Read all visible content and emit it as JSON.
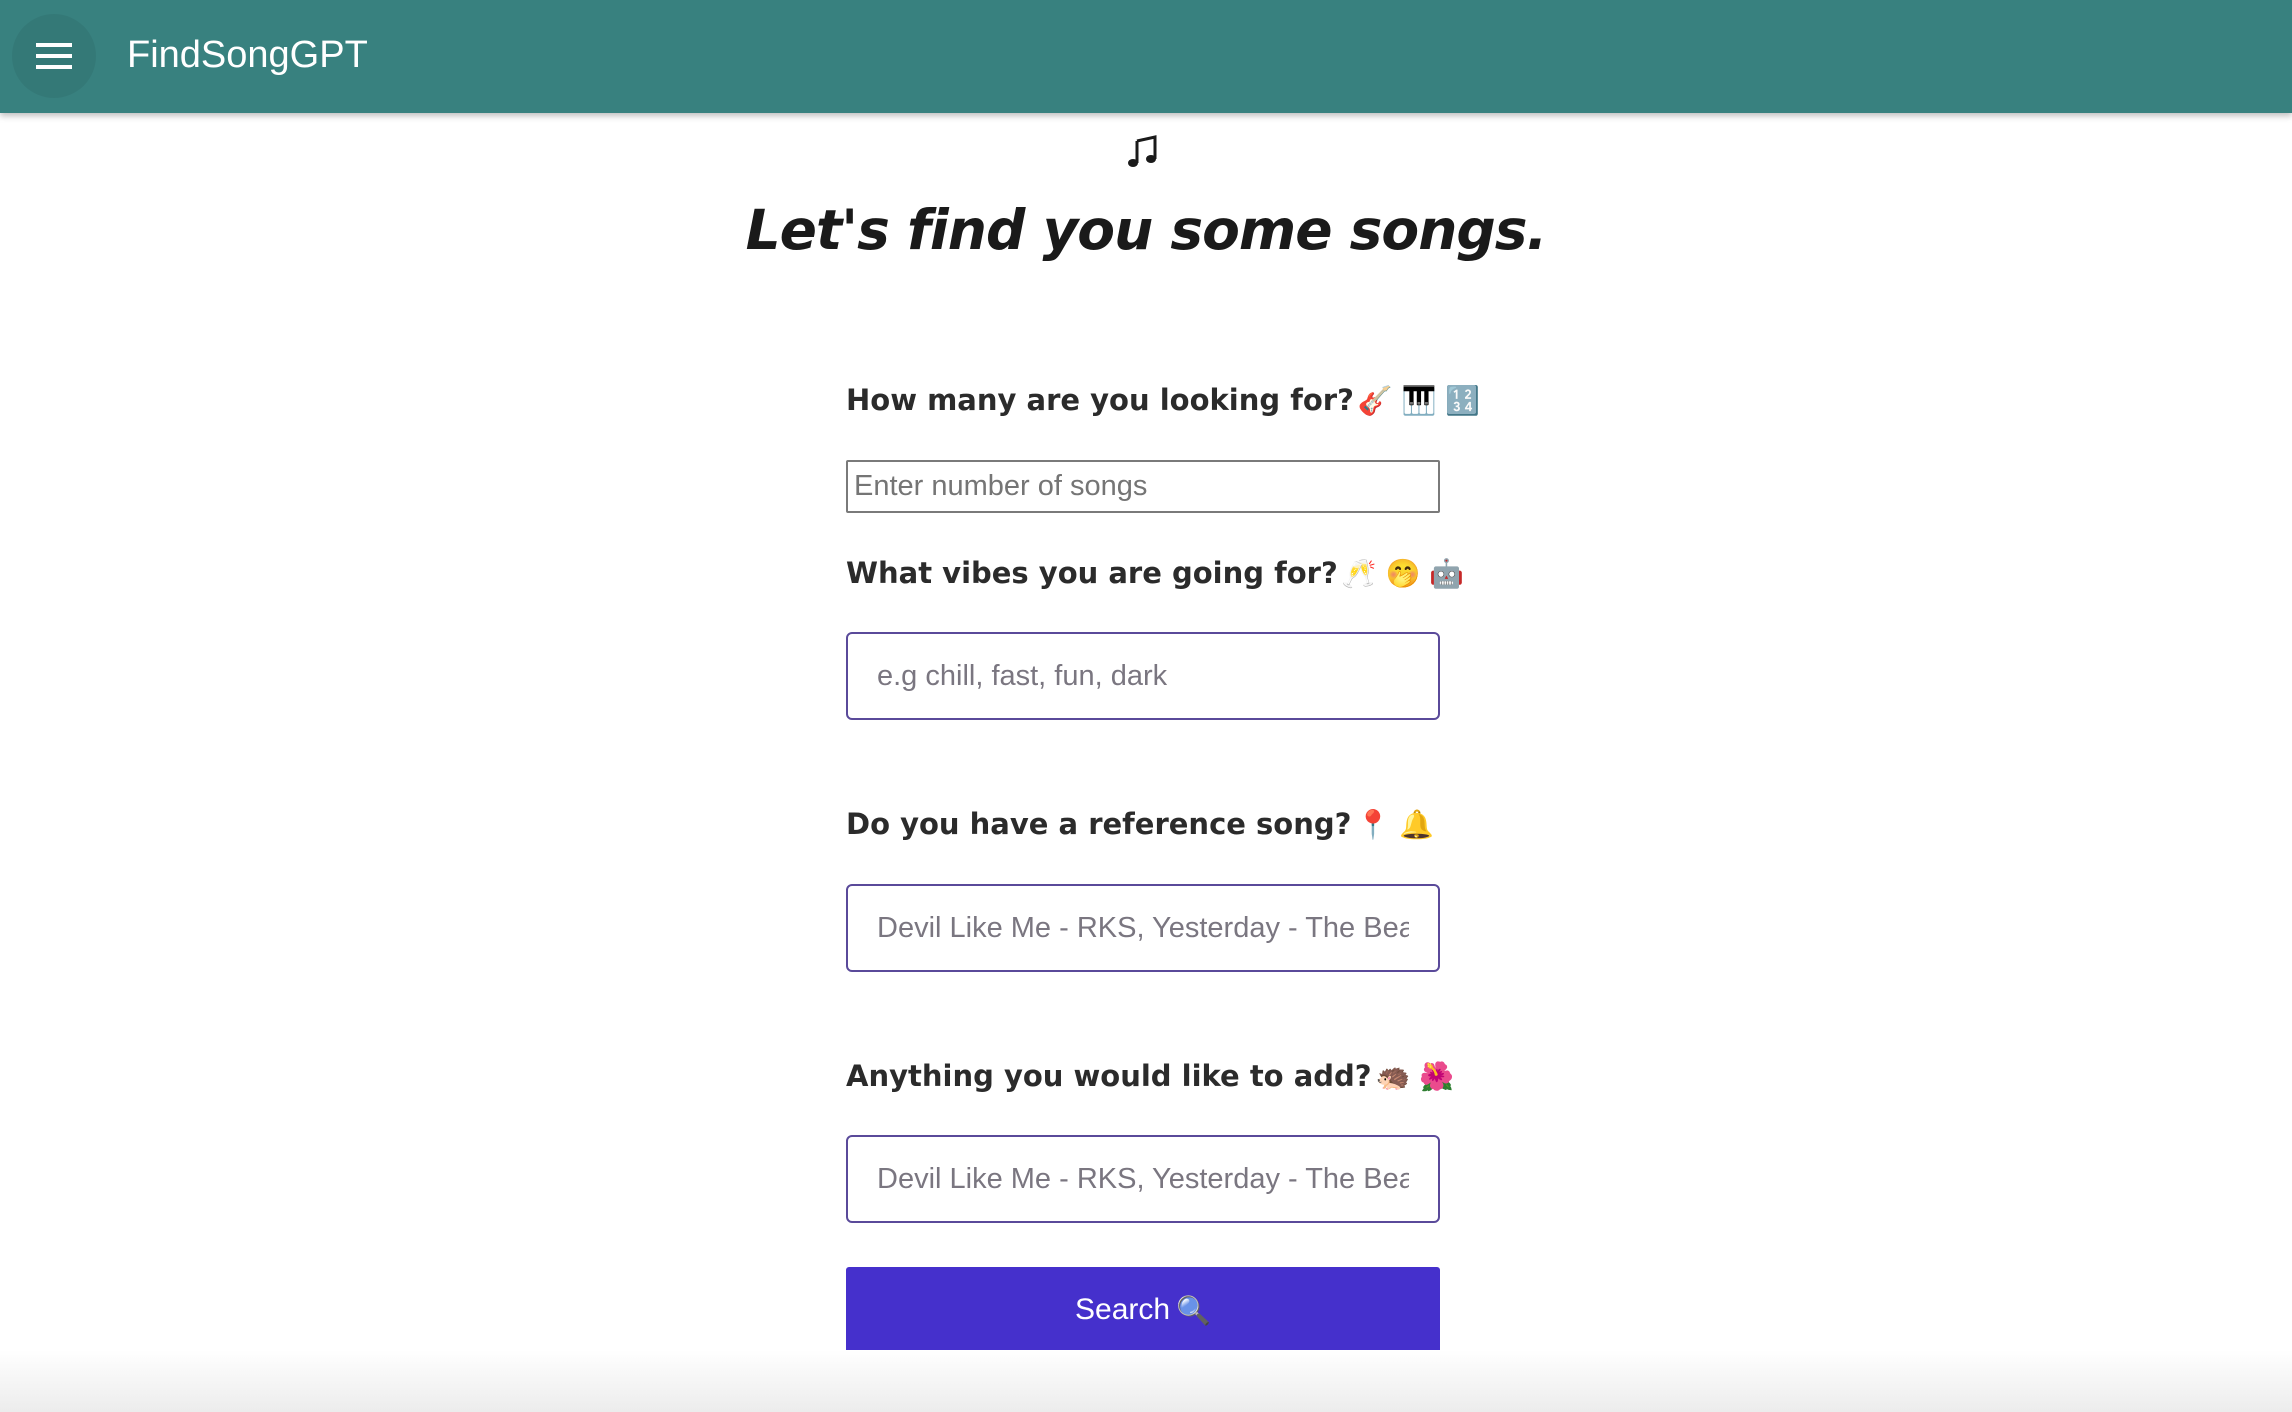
{
  "app": {
    "title": "FindSongGPT",
    "accent_color": "#38817f",
    "button_color": "#4530cc",
    "menu_icon": "hamburger-menu-icon",
    "note_icon": "music-note-icon"
  },
  "headline": "Let's find you some songs.",
  "form": {
    "count": {
      "label": "How many are you looking for?",
      "emoji": "🎸 🎹 🔢",
      "placeholder": "Enter number of songs"
    },
    "vibes": {
      "label": "What vibes you are going for?",
      "emoji": "🥂 🤭 🤖",
      "placeholder": "e.g chill, fast, fun, dark"
    },
    "reference": {
      "label": "Do you have a reference song?",
      "emoji": "📍 🔔",
      "placeholder": "Devil Like Me - RKS, Yesterday - The Beatles"
    },
    "extra": {
      "label": "Anything you would like to add?",
      "emoji": "🦔 🌺",
      "placeholder": "Devil Like Me - RKS, Yesterday - The Beatles"
    },
    "submit": {
      "label": "Search",
      "emoji": "🔍"
    }
  }
}
